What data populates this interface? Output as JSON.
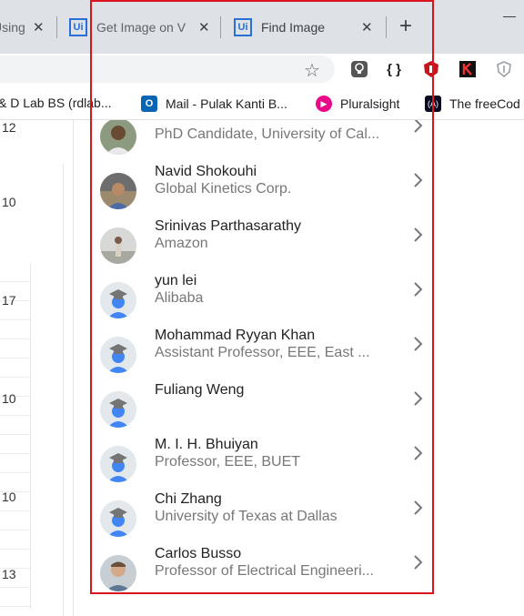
{
  "browser": {
    "tabs": [
      {
        "title": "Using",
        "favicon": ""
      },
      {
        "title": "Get Image on V",
        "favicon": "Ui"
      },
      {
        "title": "Find Image",
        "favicon": "Ui"
      }
    ],
    "new_tab_symbol": "+",
    "close_symbol": "✕",
    "bookmarks": [
      {
        "label": "& D Lab BS (rdlab...",
        "icon": "none"
      },
      {
        "label": "Mail - Pulak Kanti B...",
        "icon": "outlook-icon",
        "color": "#0a64b4"
      },
      {
        "label": "Pluralsight",
        "icon": "pluralsight-icon",
        "color": "#e80a89"
      },
      {
        "label": "The freeCod",
        "icon": "freecodecamp-icon",
        "color": "#0a0a23"
      }
    ],
    "extensions": [
      {
        "name": "lightbulb-extension-icon",
        "glyph": "💡"
      },
      {
        "name": "json-extension-icon",
        "glyph": "{ }"
      },
      {
        "name": "ublock-extension-icon",
        "glyph": "⬢"
      },
      {
        "name": "k-extension-icon",
        "glyph": "K"
      },
      {
        "name": "shield-extension-icon",
        "glyph": "⛉"
      }
    ]
  },
  "background": {
    "numbers": [
      "12",
      "10",
      "17",
      "10",
      "10",
      "13"
    ]
  },
  "people": [
    {
      "name": "",
      "affiliation": "PhD Candidate, University of Cal...",
      "avatar": "photo"
    },
    {
      "name": "Navid Shokouhi",
      "affiliation": "Global Kinetics Corp.",
      "avatar": "photo"
    },
    {
      "name": "Srinivas Parthasarathy",
      "affiliation": "Amazon",
      "avatar": "photo"
    },
    {
      "name": "yun lei",
      "affiliation": "Alibaba",
      "avatar": "default"
    },
    {
      "name": "Mohammad Ryyan Khan",
      "affiliation": "Assistant Professor, EEE, East ...",
      "avatar": "default"
    },
    {
      "name": "Fuliang Weng",
      "affiliation": "",
      "avatar": "default"
    },
    {
      "name": "M. I. H. Bhuiyan",
      "affiliation": "Professor, EEE, BUET",
      "avatar": "default"
    },
    {
      "name": "Chi Zhang",
      "affiliation": "University of Texas at Dallas",
      "avatar": "default"
    },
    {
      "name": "Carlos Busso",
      "affiliation": "Professor of Electrical Engineeri...",
      "avatar": "photo"
    }
  ],
  "colors": {
    "highlight_frame": "#d9141c",
    "scholar_avatar_blue": "#4285f4",
    "scholar_cap_gray": "#757575"
  }
}
